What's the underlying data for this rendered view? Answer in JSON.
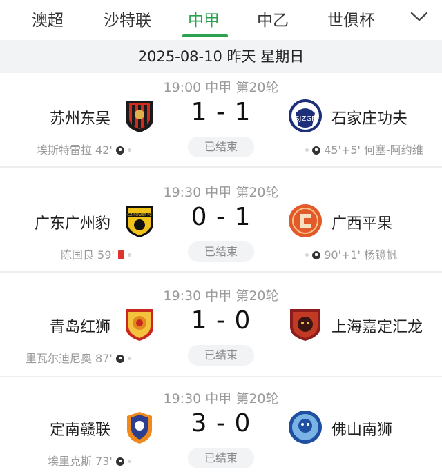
{
  "tabs": {
    "items": [
      "澳超",
      "沙特联",
      "中甲",
      "中乙",
      "世俱杯"
    ],
    "active": "中甲"
  },
  "date_header": "2025-08-10 昨天 星期日",
  "matches": [
    {
      "meta": "19:00 中甲 第20轮",
      "home": "苏州东吴",
      "away": "石家庄功夫",
      "score": "1 - 1",
      "status": "已结束",
      "home_event": "埃斯特雷拉 42'",
      "away_event": "45'+5' 何塞-阿约维",
      "home_event_icon": "ball-icon",
      "away_event_icon": "ball-icon"
    },
    {
      "meta": "19:30 中甲 第20轮",
      "home": "广东广州豹",
      "away": "广西平果",
      "score": "0 - 1",
      "status": "已结束",
      "home_event": "陈国良 59'",
      "away_event": "90'+1' 杨镜帆",
      "home_event_icon": "red-card-icon",
      "away_event_icon": "ball-icon"
    },
    {
      "meta": "19:30 中甲 第20轮",
      "home": "青岛红狮",
      "away": "上海嘉定汇龙",
      "score": "1 - 0",
      "status": "已结束",
      "home_event": "里瓦尔迪尼奥 87'",
      "away_event": "",
      "home_event_icon": "ball-icon",
      "away_event_icon": ""
    },
    {
      "meta": "19:30 中甲 第20轮",
      "home": "定南赣联",
      "away": "佛山南狮",
      "score": "3 - 0",
      "status": "已结束",
      "home_event": "埃里克斯 73'",
      "away_event": "",
      "home_event_icon": "ball-icon",
      "away_event_icon": ""
    }
  ],
  "colors": {
    "accent": "#2aa24f",
    "date_bar_bg": "#f2f3f5",
    "red_card": "#e0322f"
  }
}
